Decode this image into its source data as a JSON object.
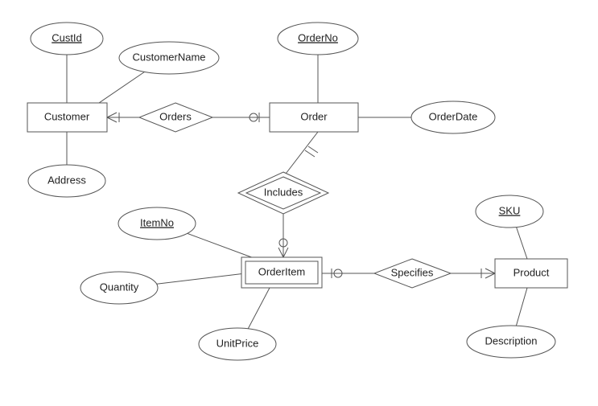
{
  "entities": {
    "customer": "Customer",
    "order": "Order",
    "orderitem": "OrderItem",
    "product": "Product"
  },
  "relationships": {
    "orders": "Orders",
    "includes": "Includes",
    "specifies": "Specifies"
  },
  "attributes": {
    "custid": "CustId",
    "customername": "CustomerName",
    "address": "Address",
    "orderno": "OrderNo",
    "orderdate": "OrderDate",
    "itemno": "ItemNo",
    "quantity": "Quantity",
    "unitprice": "UnitPrice",
    "sku": "SKU",
    "description": "Description"
  }
}
